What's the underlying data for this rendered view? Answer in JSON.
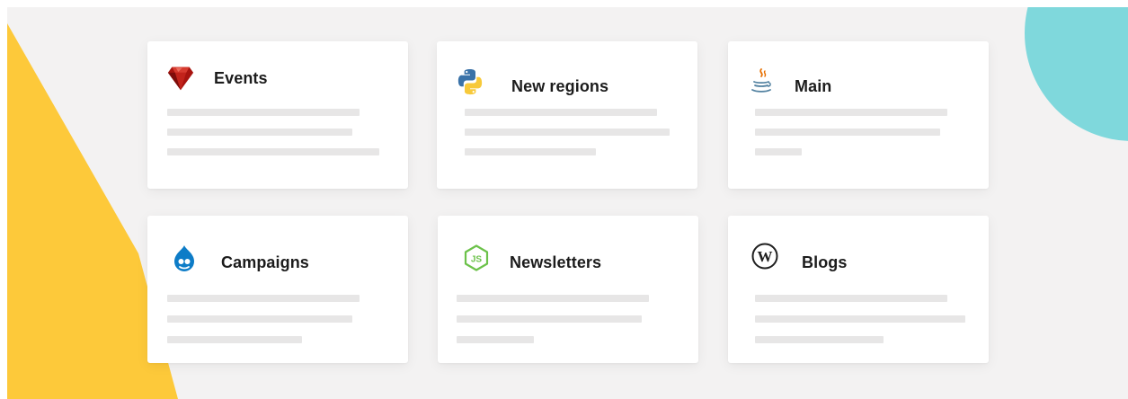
{
  "theme": {
    "canvas_background": "#f3f2f2",
    "card_background": "#ffffff",
    "placeholder_line": "#e7e6e6",
    "accent_teal": "#7fd8dc",
    "accent_yellow": "#fdc93a",
    "title_color": "#1c1c1c"
  },
  "cards": [
    {
      "title": "Events",
      "icon": "ruby-icon"
    },
    {
      "title": "New regions",
      "icon": "python-icon"
    },
    {
      "title": "Main",
      "icon": "java-icon"
    },
    {
      "title": "Campaigns",
      "icon": "drupal-icon"
    },
    {
      "title": "Newsletters",
      "icon": "nodejs-icon"
    },
    {
      "title": "Blogs",
      "icon": "wordpress-icon"
    }
  ]
}
